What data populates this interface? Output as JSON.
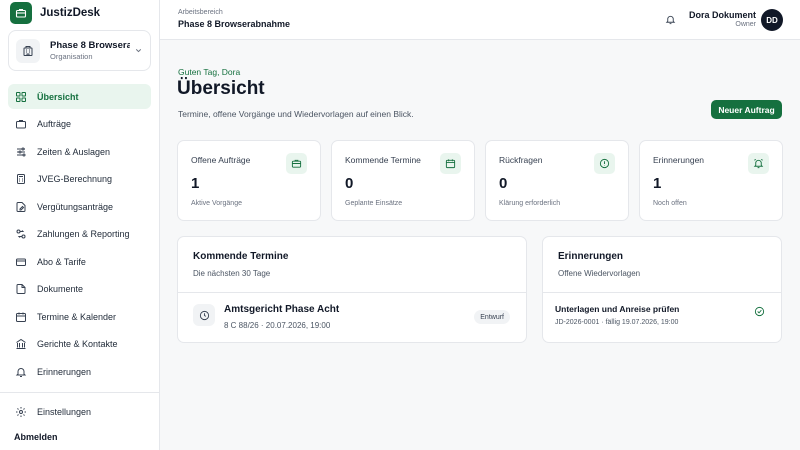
{
  "brand": {
    "name": "JustizDesk",
    "logo_icon": "briefcase-icon"
  },
  "org": {
    "name": "Phase 8 Browsera...",
    "type": "Organisation"
  },
  "nav": [
    {
      "label": "Übersicht",
      "icon": "home-icon",
      "active": true
    },
    {
      "label": "Aufträge",
      "icon": "briefcase-icon"
    },
    {
      "label": "Zeiten & Auslagen",
      "icon": "sliders-icon"
    },
    {
      "label": "JVEG-Berechnung",
      "icon": "calculator-icon"
    },
    {
      "label": "Vergütungsanträge",
      "icon": "file-edit-icon"
    },
    {
      "label": "Zahlungen & Reporting",
      "icon": "transfer-icon"
    },
    {
      "label": "Abo & Tarife",
      "icon": "card-icon"
    },
    {
      "label": "Dokumente",
      "icon": "document-icon"
    },
    {
      "label": "Termine & Kalender",
      "icon": "calendar-icon"
    },
    {
      "label": "Gerichte & Kontakte",
      "icon": "building-icon"
    },
    {
      "label": "Erinnerungen",
      "icon": "bell-icon"
    }
  ],
  "settings": {
    "label": "Einstellungen",
    "icon": "gear-icon"
  },
  "logout": {
    "label": "Abmelden"
  },
  "header": {
    "workspace_label": "Arbeitsbereich",
    "workspace_name": "Phase 8 Browserabnahme",
    "user_name": "Dora Dokument",
    "user_role": "Owner",
    "user_initials": "DD"
  },
  "main": {
    "greeting": "Guten Tag, Dora",
    "title": "Übersicht",
    "subtitle": "Termine, offene Vorgänge und Wiedervorlagen auf einen Blick.",
    "new_button": "Neuer Auftrag"
  },
  "stats": [
    {
      "label": "Offene Aufträge",
      "value": "1",
      "hint": "Aktive Vorgänge",
      "icon": "briefcase-icon"
    },
    {
      "label": "Kommende Termine",
      "value": "0",
      "hint": "Geplante Einsätze",
      "icon": "calendar-icon"
    },
    {
      "label": "Rückfragen",
      "value": "0",
      "hint": "Klärung erforderlich",
      "icon": "alert-circle-icon"
    },
    {
      "label": "Erinnerungen",
      "value": "1",
      "hint": "Noch offen",
      "icon": "alarm-icon"
    }
  ],
  "appointments": {
    "title": "Kommende Termine",
    "subtitle": "Die nächsten 30 Tage",
    "items": [
      {
        "title": "Amtsgericht Phase Acht",
        "meta": "8 C 88/26 · 20.07.2026, 19:00",
        "status": "Entwurf"
      }
    ]
  },
  "reminders": {
    "title": "Erinnerungen",
    "subtitle": "Offene Wiedervorlagen",
    "items": [
      {
        "title": "Unterlagen und Anreise prüfen",
        "meta": "JD-2026-0001 · fällig 19.07.2026, 19:00"
      }
    ]
  },
  "colors": {
    "accent": "#15703f",
    "accent_soft": "#e9f5ee"
  }
}
